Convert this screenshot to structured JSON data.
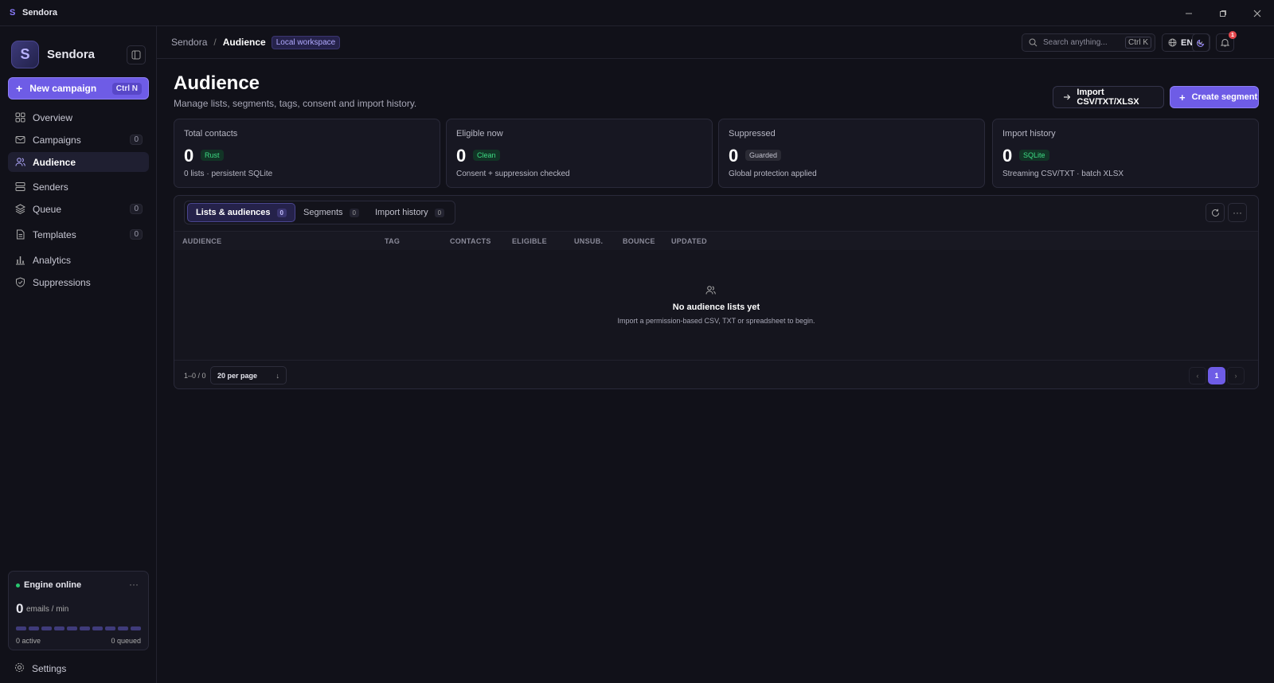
{
  "titlebar": {
    "app_name": "Sendora",
    "logo_letter": "S"
  },
  "sidebar": {
    "brand": "Sendora",
    "brand_letter": "S",
    "new_campaign": {
      "label": "New campaign",
      "shortcut": "Ctrl N"
    },
    "items": [
      {
        "label": "Overview",
        "icon": "grid-icon",
        "count": null
      },
      {
        "label": "Campaigns",
        "icon": "mail-icon",
        "count": "0"
      },
      {
        "label": "Audience",
        "icon": "users-icon",
        "count": null,
        "active": true
      },
      {
        "label": "Senders",
        "icon": "server-icon",
        "count": null
      },
      {
        "label": "Queue",
        "icon": "layers-icon",
        "count": "0"
      },
      {
        "label": "Templates",
        "icon": "file-icon",
        "count": "0"
      },
      {
        "label": "Analytics",
        "icon": "bar-chart-icon",
        "count": null
      },
      {
        "label": "Suppressions",
        "icon": "shield-icon",
        "count": null
      }
    ],
    "engine": {
      "status": "Engine online",
      "rate": "0",
      "rate_unit": "emails / min",
      "active": "0 active",
      "queued": "0 queued"
    },
    "settings": "Settings"
  },
  "topbar": {
    "breadcrumb_root": "Sendora",
    "breadcrumb_sep": "/",
    "breadcrumb_current": "Audience",
    "workspace": "Local workspace",
    "search_placeholder": "Search anything...",
    "search_shortcut": "Ctrl K",
    "language": "EN",
    "notifications": "1"
  },
  "page": {
    "title": "Audience",
    "subtitle": "Manage lists, segments, tags, consent and import history.",
    "import_button": "Import CSV/TXT/XLSX",
    "create_button": "Create segment"
  },
  "stats": [
    {
      "label": "Total contacts",
      "value": "0",
      "pill": "Rust",
      "pill_style": "green",
      "desc": "0 lists · persistent SQLite"
    },
    {
      "label": "Eligible now",
      "value": "0",
      "pill": "Clean",
      "pill_style": "green",
      "desc": "Consent + suppression checked"
    },
    {
      "label": "Suppressed",
      "value": "0",
      "pill": "Guarded",
      "pill_style": "gray",
      "desc": "Global protection applied"
    },
    {
      "label": "Import history",
      "value": "0",
      "pill": "SQLite",
      "pill_style": "green",
      "desc": "Streaming CSV/TXT · batch XLSX"
    }
  ],
  "tabs": [
    {
      "label": "Lists & audiences",
      "count": "0"
    },
    {
      "label": "Segments",
      "count": "0"
    },
    {
      "label": "Import history",
      "count": "0"
    }
  ],
  "table": {
    "columns": [
      "AUDIENCE",
      "TAG",
      "CONTACTS",
      "ELIGIBLE",
      "UNSUB.",
      "BOUNCE",
      "UPDATED"
    ],
    "empty_title": "No audience lists yet",
    "empty_desc": "Import a permission-based CSV, TXT or spreadsheet to begin."
  },
  "pagination": {
    "range": "1–0 / 0",
    "per_page": "20 per page",
    "current_page": "1"
  },
  "colors": {
    "accent": "#6e5ce6",
    "background": "#111119",
    "success": "#3ddc84",
    "danger": "#e5484d"
  }
}
